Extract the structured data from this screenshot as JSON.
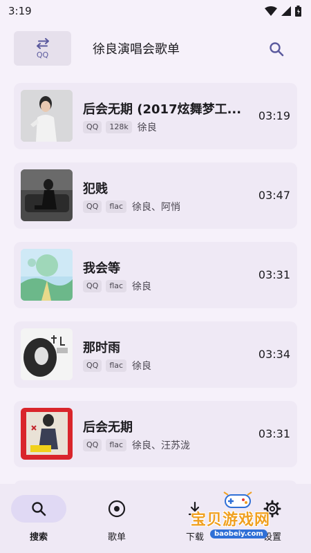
{
  "status_bar": {
    "time": "3:19"
  },
  "header": {
    "source_label": "QQ",
    "title": "徐良演唱会歌单"
  },
  "songs": [
    {
      "title": "后会无期 (2017炫舞梦工...",
      "tags": [
        "QQ",
        "128k"
      ],
      "artist": "徐良",
      "duration": "03:19"
    },
    {
      "title": "犯贱",
      "tags": [
        "QQ",
        "flac"
      ],
      "artist": "徐良、阿悄",
      "duration": "03:47"
    },
    {
      "title": "我会等",
      "tags": [
        "QQ",
        "flac"
      ],
      "artist": "徐良",
      "duration": "03:31"
    },
    {
      "title": "那时雨",
      "tags": [
        "QQ",
        "flac"
      ],
      "artist": "徐良",
      "duration": "03:34"
    },
    {
      "title": "后会无期",
      "tags": [
        "QQ",
        "flac"
      ],
      "artist": "徐良、汪苏泷",
      "duration": "03:31"
    }
  ],
  "nav": {
    "items": [
      {
        "label": "搜索",
        "icon": "search-icon",
        "active": true
      },
      {
        "label": "歌单",
        "icon": "album-icon",
        "active": false
      },
      {
        "label": "下载",
        "icon": "download-icon",
        "active": false
      },
      {
        "label": "设置",
        "icon": "gear-icon",
        "active": false
      }
    ]
  },
  "watermark": {
    "text": "宝贝游戏网",
    "url": "baobeiy.com"
  },
  "colors": {
    "accent": "#5b5a9e",
    "background": "#f6f1fa",
    "card": "#efe9f5"
  }
}
